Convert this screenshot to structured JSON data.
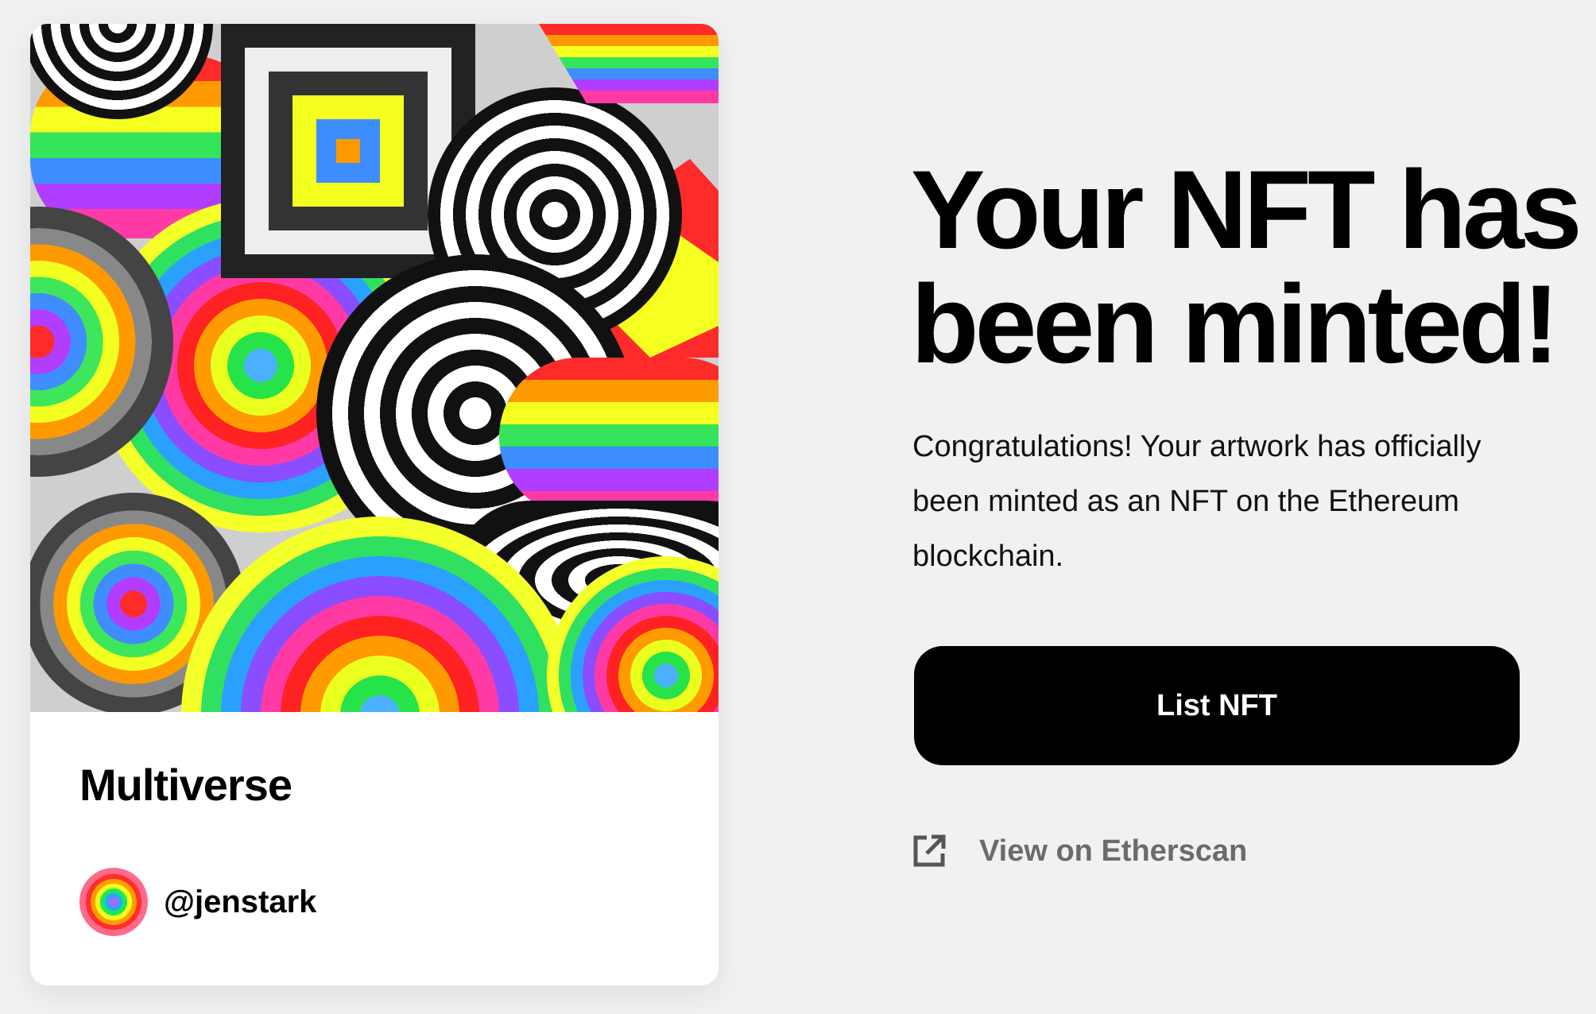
{
  "card": {
    "title": "Multiverse",
    "creator_handle": "@jenstark",
    "artwork_icon": "psychedelic-rainbow-artwork",
    "avatar_icon": "rainbow-circle-avatar"
  },
  "hero": {
    "headline": "Your NFT has been minted!",
    "body": "Congratulations! Your artwork has officially been minted as an NFT on the Ethereum blockchain."
  },
  "actions": {
    "primary_label": "List NFT",
    "secondary_label": "View on Etherscan",
    "secondary_icon": "external-link-icon"
  },
  "colors": {
    "background": "#f1f1f1",
    "button": "#000000",
    "link": "#6b6b6b"
  }
}
